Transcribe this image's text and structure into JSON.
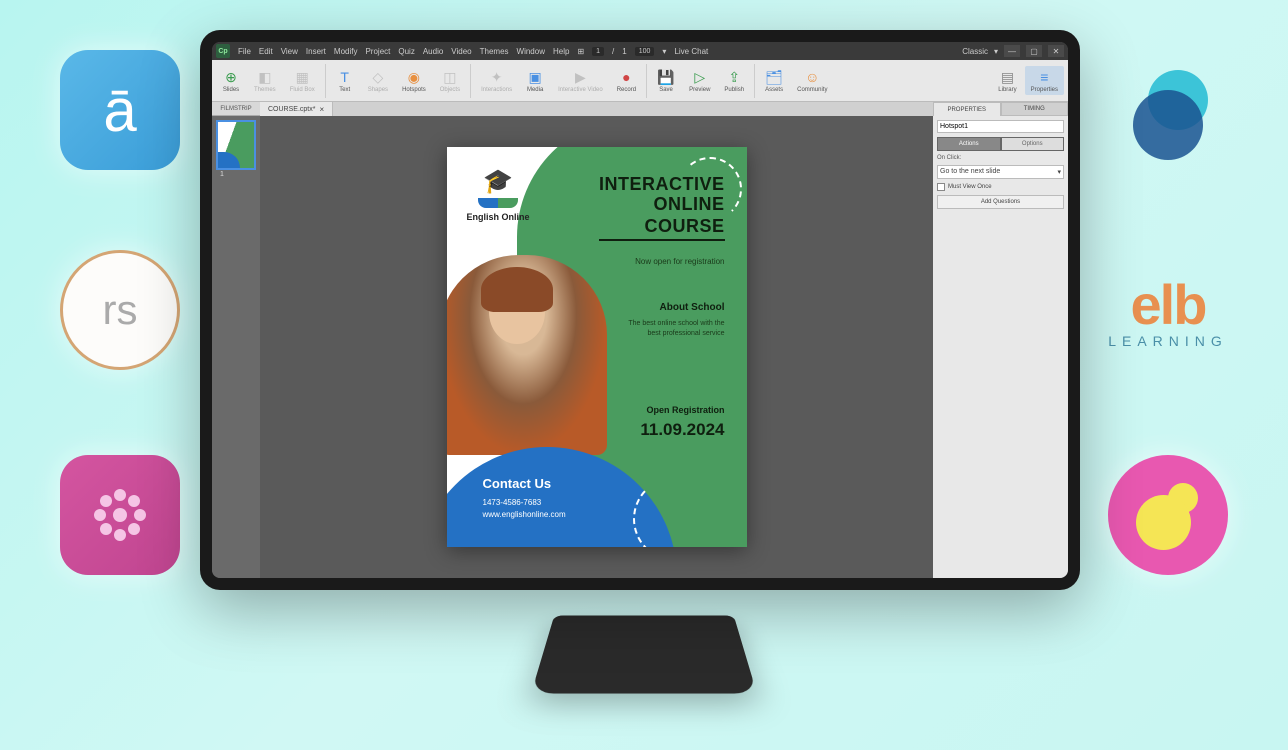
{
  "menubar": {
    "items": [
      "File",
      "Edit",
      "View",
      "Insert",
      "Modify",
      "Project",
      "Quiz",
      "Audio",
      "Video",
      "Themes",
      "Window",
      "Help"
    ],
    "field1": "1",
    "field2": "1",
    "field3": "100",
    "live_chat": "Live Chat",
    "mode": "Classic"
  },
  "toolbar": {
    "slides": "Slides",
    "themes": "Themes",
    "fluid_box": "Fluid Box",
    "text": "Text",
    "shapes": "Shapes",
    "hotspots": "Hotspots",
    "objects": "Objects",
    "interactions": "Interactions",
    "media": "Media",
    "interactive_video": "Interactive Video",
    "record": "Record",
    "save": "Save",
    "preview": "Preview",
    "publish": "Publish",
    "assets": "Assets",
    "community": "Community",
    "library": "Library",
    "properties": "Properties"
  },
  "filmstrip": {
    "header": "FILMSTRIP",
    "thumb_num": "1"
  },
  "doc_tab": {
    "name": "COURSE.cptx*",
    "close": "×"
  },
  "slide": {
    "brand": "English Online",
    "title1": "INTERACTIVE",
    "title2": "ONLINE",
    "title3": "COURSE",
    "subtitle": "Now open for registration",
    "about_h": "About School",
    "about_t": "The best online school with the best professional service",
    "reg_h": "Open Registration",
    "date": "11.09.2024",
    "contact_h": "Contact Us",
    "phone": "1473-4586-7683",
    "web": "www.englishonline.com"
  },
  "panel": {
    "tab_properties": "PROPERTIES",
    "tab_timing": "TIMING",
    "object_name": "Hotspot1",
    "actions": "Actions",
    "options": "Options",
    "on_click": "On Click:",
    "on_click_value": "Go to the next slide",
    "must_view": "Must View Once",
    "add_questions": "Add Questions"
  },
  "brands": {
    "a": "ā",
    "rs": "rs",
    "elb": "elb",
    "learning": "LEARNING"
  }
}
